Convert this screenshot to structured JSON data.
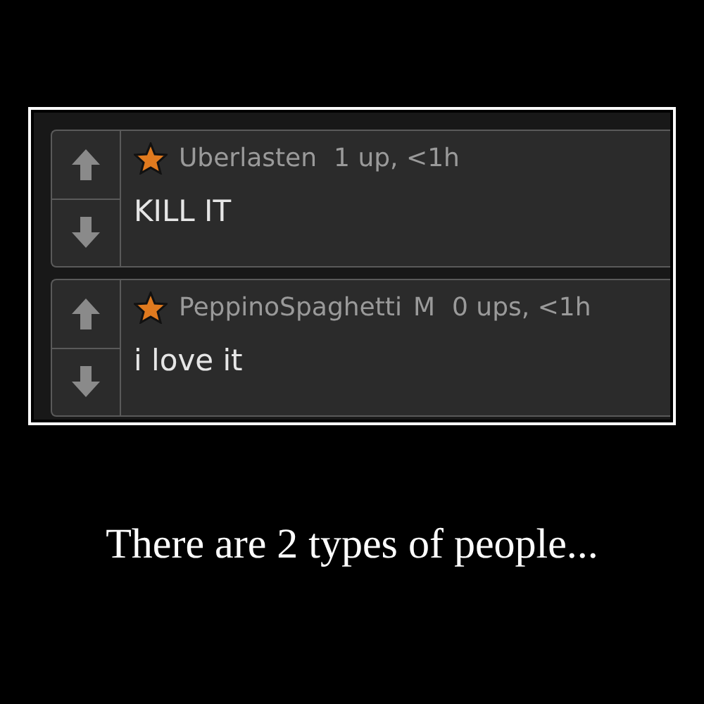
{
  "comments": [
    {
      "user": "Uberlasten",
      "meta": "1 up, <1h",
      "text": "KILL IT"
    },
    {
      "user": "PeppinoSpaghetti",
      "tag": "M",
      "meta": "0 ups, <1h",
      "text": "i love it"
    }
  ],
  "caption": "There are 2 types of people..."
}
